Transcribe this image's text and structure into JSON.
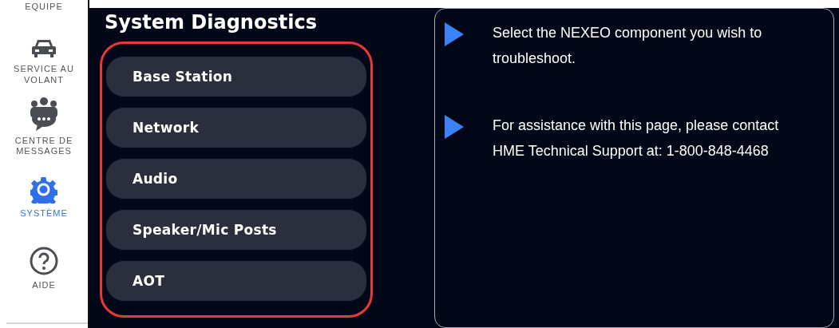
{
  "sidebar": {
    "items": [
      {
        "label": "EQUIPE",
        "kind": "team",
        "selected": false
      },
      {
        "label": "SERVICE AU VOLANT",
        "kind": "car",
        "selected": false
      },
      {
        "label": "CENTRE DE MESSAGES",
        "kind": "messages",
        "selected": false
      },
      {
        "label": "SYSTÈME",
        "kind": "gear",
        "selected": true
      },
      {
        "label": "AIDE",
        "kind": "help",
        "selected": false
      }
    ]
  },
  "title": "System Diagnostics",
  "components": [
    {
      "label": "Base Station"
    },
    {
      "label": "Network"
    },
    {
      "label": "Audio"
    },
    {
      "label": "Speaker/Mic Posts"
    },
    {
      "label": "AOT"
    }
  ],
  "info": [
    "Select the NEXEO component you wish to troubleshoot.",
    "For assistance with this page, please contact HME Technical Support at: 1-800-848-4468"
  ]
}
